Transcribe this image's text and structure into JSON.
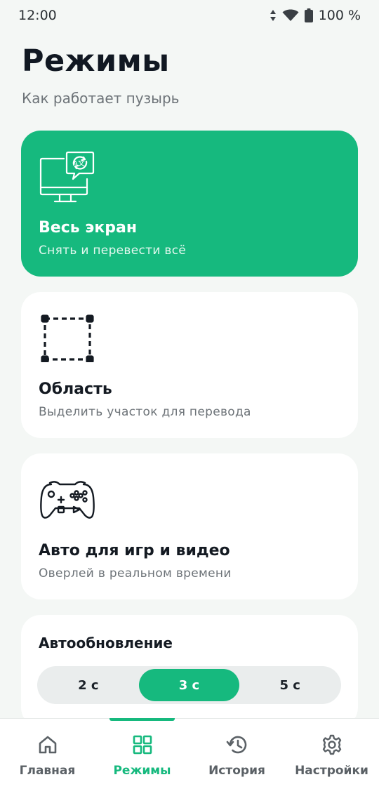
{
  "status_bar": {
    "time": "12:00",
    "battery": "100 %"
  },
  "header": {
    "title": "Режимы",
    "subtitle": "Как работает пузырь"
  },
  "modes": [
    {
      "title": "Весь экран",
      "description": "Снять и перевести всё",
      "icon": "monitor-translate-icon"
    },
    {
      "title": "Область",
      "description": "Выделить участок для перевода",
      "icon": "region-select-icon"
    },
    {
      "title": "Авто для игр и видео",
      "description": "Оверлей в реальном времени",
      "icon": "gamepad-icon"
    }
  ],
  "auto_refresh": {
    "label": "Автообновление",
    "options": [
      "2 с",
      "3 с",
      "5 с"
    ],
    "selected": "3 с"
  },
  "bottom_nav": [
    {
      "label": "Главная",
      "icon": "home-icon"
    },
    {
      "label": "Режимы",
      "icon": "grid-icon"
    },
    {
      "label": "История",
      "icon": "history-icon"
    },
    {
      "label": "Настройки",
      "icon": "gear-icon"
    }
  ],
  "colors": {
    "accent": "#16b97e",
    "background": "#f4f7f5",
    "card": "#ffffff",
    "title": "#111822"
  }
}
